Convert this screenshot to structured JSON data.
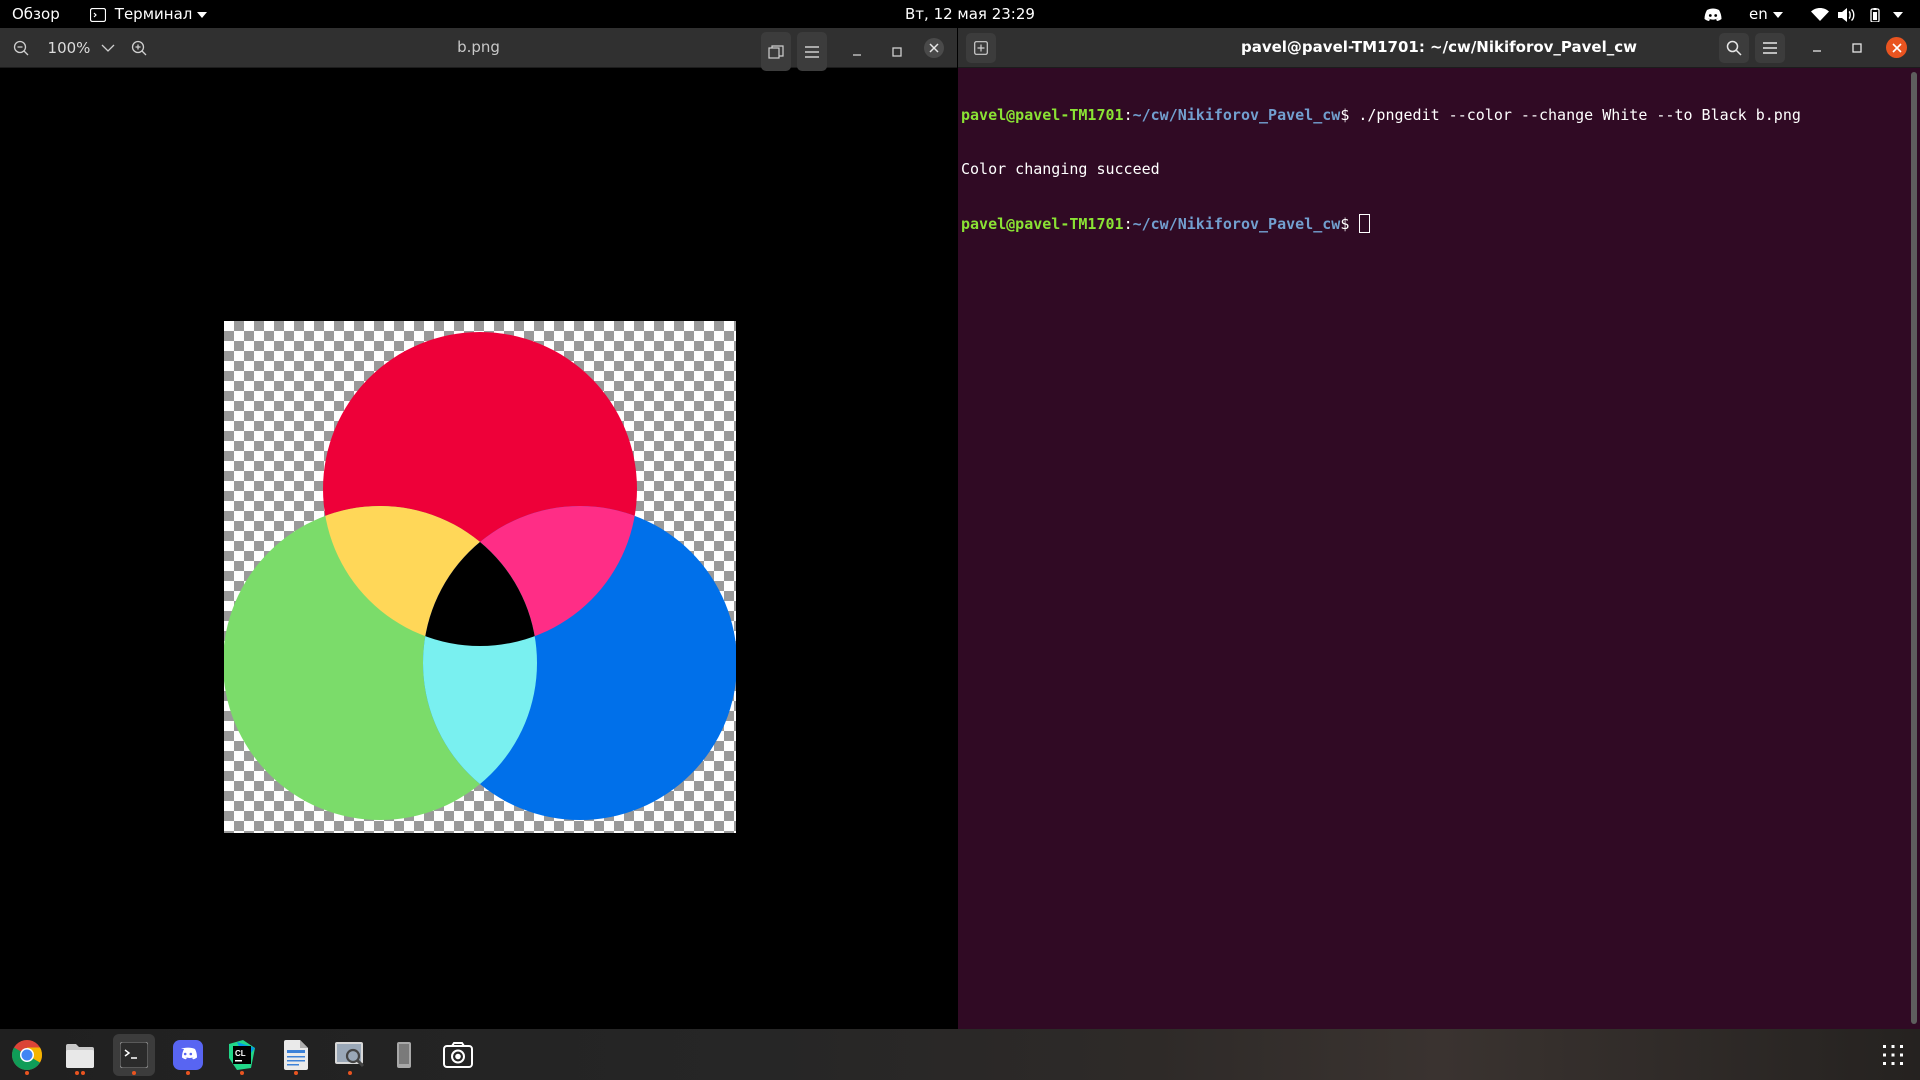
{
  "topbar": {
    "activities": "Обзор",
    "app_menu": "Терминал",
    "clock": "Вт, 12 мая  23:29",
    "language": "en"
  },
  "viewer": {
    "zoom": "100%",
    "title": "b.png"
  },
  "terminal": {
    "title": "pavel@pavel-TM1701: ~/cw/Nikiforov_Pavel_cw",
    "lines": [
      {
        "user": "pavel@pavel-TM1701",
        "sep": ":",
        "path": "~/cw/Nikiforov_Pavel_cw",
        "sym": "$ ",
        "cmd": "./pngedit --color --change White --to Black b.png"
      },
      {
        "text": "Color changing succeed"
      },
      {
        "user": "pavel@pavel-TM1701",
        "sep": ":",
        "path": "~/cw/Nikiforov_Pavel_cw",
        "sym": "$ ",
        "cmd": ""
      }
    ]
  },
  "image_colors": {
    "red": "#ee0039",
    "green": "#7bdc6a",
    "blue": "#0070ea",
    "yellow": "#ffd758",
    "magenta": "#ff2d86",
    "cyan": "#79f0f0",
    "center": "#000000"
  },
  "dock": {
    "apps": [
      "chrome-icon",
      "files-icon",
      "terminal-icon",
      "discord-icon",
      "clion-icon",
      "text-editor-icon",
      "image-viewer-icon",
      "device-icon",
      "screenshot-icon"
    ],
    "grid": "show-applications-icon"
  }
}
